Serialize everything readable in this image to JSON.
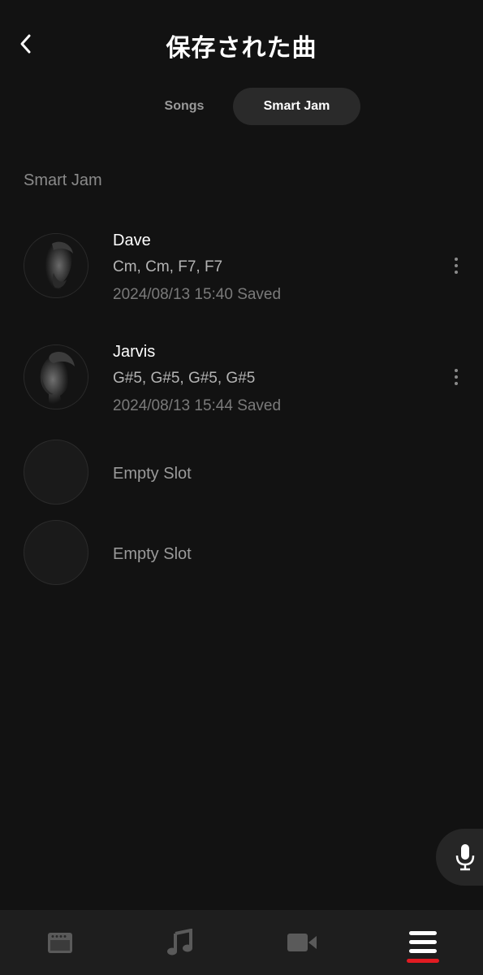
{
  "header": {
    "title": "保存された曲",
    "back_icon": "chevron-left-icon"
  },
  "tabs": [
    {
      "label": "Songs",
      "active": false
    },
    {
      "label": "Smart Jam",
      "active": true
    }
  ],
  "section": {
    "label": "Smart Jam"
  },
  "saved_items": [
    {
      "name": "Dave",
      "chords": "Cm, Cm, F7, F7",
      "saved": "2024/08/13 15:40 Saved",
      "avatar": "man-portrait-profile-avatar"
    },
    {
      "name": "Jarvis",
      "chords": "G#5, G#5, G#5, G#5",
      "saved": "2024/08/13 15:44 Saved",
      "avatar": "man-portrait-profile-avatar"
    }
  ],
  "empty_slots": [
    {
      "label": "Empty Slot"
    },
    {
      "label": "Empty Slot"
    }
  ],
  "floating": {
    "icon": "microphone-icon"
  },
  "bottom_nav": [
    {
      "icon": "amplifier-icon",
      "active": false
    },
    {
      "icon": "music-note-icon",
      "active": false
    },
    {
      "icon": "video-camera-icon",
      "active": false
    },
    {
      "icon": "menu-icon",
      "active": true
    }
  ],
  "colors": {
    "background": "#121212",
    "tab_active_bg": "#2a2a2a",
    "nav_bg": "#1e1e1e",
    "accent": "#e11b22"
  }
}
